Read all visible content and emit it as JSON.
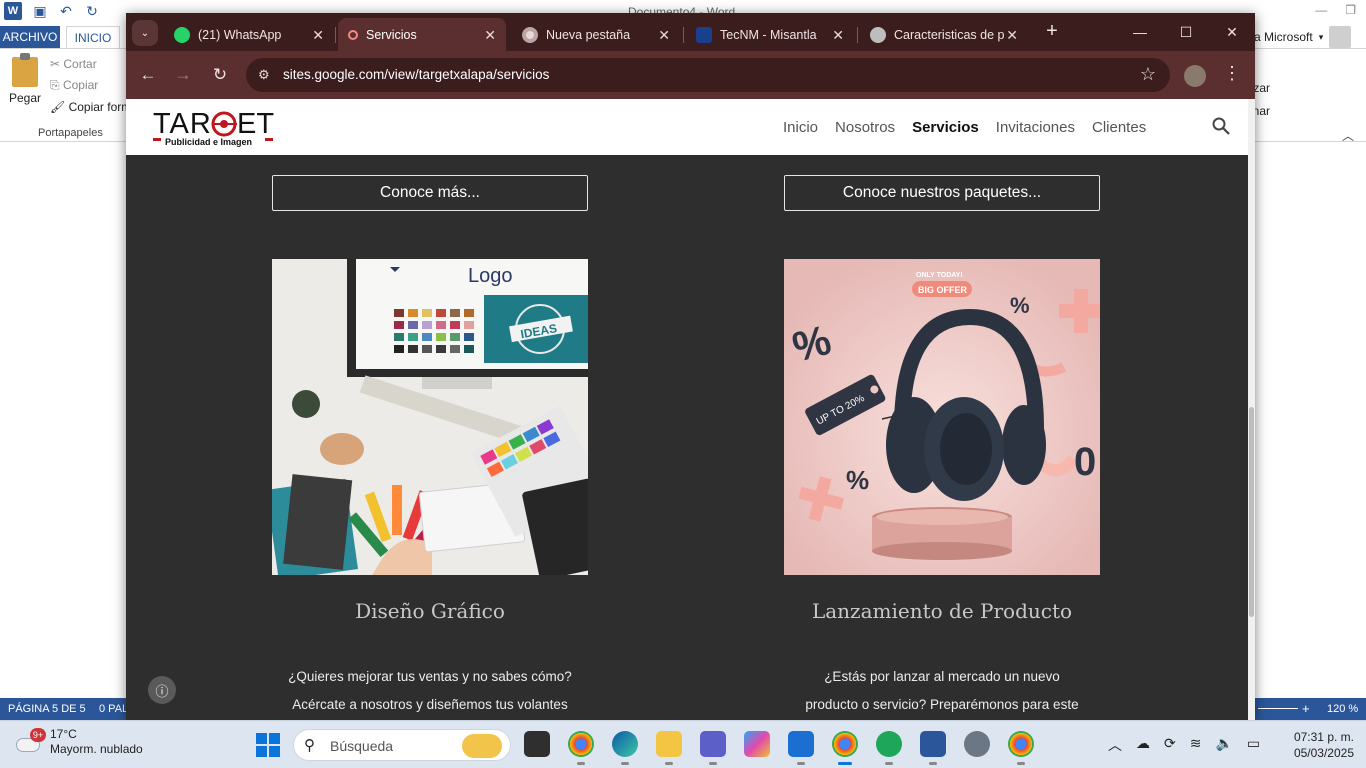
{
  "word": {
    "doc_title": "Documento4 - Word",
    "tab_archivo": "ARCHIVO",
    "tab_inicio": "INICIO",
    "user": "a Microsoft",
    "clipboard": {
      "paste": "Pegar",
      "cut": "Cortar",
      "copy": "Copiar",
      "format_painter": "Copiar form",
      "group_label": "Portapapeles"
    },
    "ribbon_right_1": "zar",
    "ribbon_right_2": "nar",
    "status_page": "PÁGINA 5 DE 5",
    "status_words": "0 PAL",
    "zoom": "120 %"
  },
  "chrome": {
    "tabs": [
      {
        "title": "(21) WhatsApp",
        "icon": "whatsapp-icon",
        "color": "#25d366"
      },
      {
        "title": "Servicios",
        "icon": "google-sites-icon",
        "color": "#f28b82",
        "active": true
      },
      {
        "title": "Nueva pestaña",
        "icon": "chrome-icon",
        "color": "#e8d8d8"
      },
      {
        "title": "TecNM - Misantla",
        "icon": "tecnm-icon",
        "color": "#1a3f8c"
      },
      {
        "title": "Caracteristicas de p",
        "icon": "globe-icon",
        "color": "#bdbdbd"
      }
    ],
    "url": "sites.google.com/view/targetxalapa/servicios"
  },
  "site": {
    "logo_text": "TARGET",
    "logo_sub": "Publicidad e Imagen",
    "nav": [
      "Inicio",
      "Nosotros",
      "Servicios",
      "Invitaciones",
      "Clientes"
    ],
    "current_nav": "Servicios",
    "left": {
      "button": "Conoce más...",
      "heading": "Diseño Gráfico",
      "line1": "¿Quieres mejorar tus ventas y no sabes cómo?",
      "line2": "Acércate a nosotros y diseñemos tus volantes",
      "image_logo_text": "Logo",
      "image_ideas_text": "IDEAS"
    },
    "right": {
      "button": "Conoce nuestros paquetes...",
      "heading": "Lanzamiento de Producto",
      "line1": "¿Estás por lanzar al mercado un nuevo",
      "line2": "producto o servicio? Preparémonos para este",
      "image_top_text": "ONLY TODAY!",
      "image_offer_text": "BIG OFFER",
      "image_tag_text": "UP TO 20%"
    }
  },
  "taskbar": {
    "weather_temp": "17°C",
    "weather_desc": "Mayorm. nublado",
    "weather_badge": "9+",
    "search_placeholder": "Búsqueda",
    "time": "07:31 p. m.",
    "date": "05/03/2025"
  }
}
